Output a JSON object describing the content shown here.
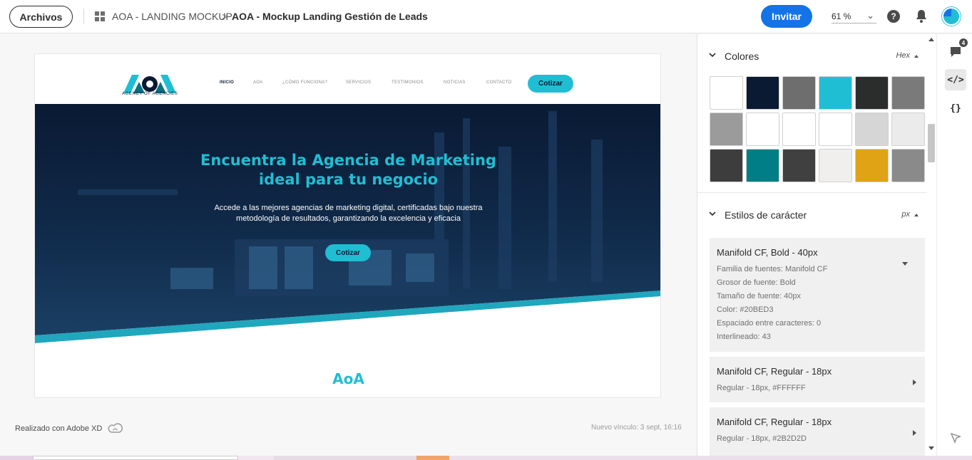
{
  "topbar": {
    "files_button": "Archivos",
    "breadcrumb_project": "AOA - LANDING MOCKUP",
    "breadcrumb_separator": ">",
    "breadcrumb_current": "AOA - Mockup Landing Gestión de Leads",
    "invite_button": "Invitar",
    "zoom_value": "61 %",
    "help_label": "?"
  },
  "mockup": {
    "logo_text": "AGENCY OF AGENCIES",
    "nav_items": [
      "INICIO",
      "AOA",
      "¿CÓMO FUNCIONA?",
      "SERVICIOS",
      "TESTIMONIOS",
      "NOTICIAS",
      "CONTACTO"
    ],
    "nav_cta": "Cotizar",
    "hero_title_line1": "Encuentra la Agencia de Marketing",
    "hero_title_line2": "ideal para tu negocio",
    "hero_sub_line1": "Accede a las mejores agencias de marketing digital, certificadas bajo nuestra",
    "hero_sub_line2": "metodología de resultados, garantizando la excelencia y eficacia",
    "hero_cta": "Cotizar",
    "section_heading": "AoA"
  },
  "footer": {
    "made_with": "Realizado con Adobe XD",
    "last_link": "Nuevo vínculo: 3 sept, 16:16"
  },
  "panel": {
    "colors_title": "Colores",
    "colors_unit": "Hex",
    "colors": [
      "#FFFFFF",
      "#0B1A33",
      "#6E6E6E",
      "#20BED3",
      "#2B2D2D",
      "#7A7A7A",
      "#9B9B9B",
      "#FFFFFF",
      "#FFFFFF",
      "#FFFFFF",
      "#D6D6D6",
      "#EBEBEB",
      "#3D3D3D",
      "#007E86",
      "#404040",
      "#F1EEEE",
      "#E0A315",
      "#8A8A8A"
    ],
    "char_styles_title": "Estilos de carácter",
    "char_styles_unit": "px",
    "styles": [
      {
        "title": "Manifold CF, Bold - 40px",
        "lines": [
          "Familia de fuentes: Manifold CF",
          "Grosor de fuente: Bold",
          "Tamaño de fuente: 40px",
          "Color: #20BED3",
          "Espaciado entre caracteres: 0",
          "Interlineado: 43"
        ]
      },
      {
        "title": "Manifold CF, Regular - 18px",
        "lines": [
          "Regular - 18px, #FFFFFF"
        ]
      },
      {
        "title": "Manifold CF, Regular - 18px",
        "lines": [
          "Regular - 18px, #2B2D2D"
        ]
      }
    ]
  },
  "rail": {
    "comments_count": "4",
    "code_icon_label": "</>",
    "braces_icon_label": "{}"
  },
  "theme": {
    "accent": "#1473E6",
    "brand_cyan": "#20BED3",
    "brand_navy": "#0B1A33"
  }
}
